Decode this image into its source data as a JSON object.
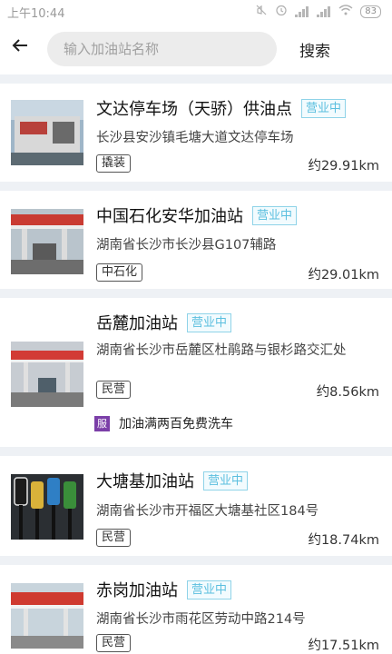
{
  "status_bar": {
    "time": "上午10:44",
    "battery": "83",
    "icons": [
      "mute-icon",
      "alarm-icon",
      "signal-icon",
      "signal-icon",
      "wifi-icon",
      "battery-icon"
    ]
  },
  "search": {
    "placeholder": "输入加油站名称",
    "button_label": "搜索",
    "back_icon": "back-arrow-icon"
  },
  "stations": [
    {
      "name": "文达停车场（天骄）供油点",
      "status": "营业中",
      "address": "长沙县安沙镇毛塘大道文达停车场",
      "tag": "撬装",
      "distance": "约29.91km",
      "promo": ""
    },
    {
      "name": "中国石化安华加油站",
      "status": "营业中",
      "address": "湖南省长沙市长沙县G107辅路",
      "tag": "中石化",
      "distance": "约29.01km",
      "promo": ""
    },
    {
      "name": "岳麓加油站",
      "status": "营业中",
      "address": "湖南省长沙市岳麓区杜鹃路与银杉路交汇处",
      "tag": "民营",
      "distance": "约8.56km",
      "promo": "加油满两百免费洗车",
      "promo_icon_label": "服"
    },
    {
      "name": "大塘基加油站",
      "status": "营业中",
      "address": "湖南省长沙市开福区大塘基社区184号",
      "tag": "民营",
      "distance": "约18.74km",
      "promo": ""
    },
    {
      "name": "赤岗加油站",
      "status": "营业中",
      "address": "湖南省长沙市雨花区劳动中路214号",
      "tag": "民营",
      "distance": "约17.51km",
      "promo": ""
    }
  ],
  "colors": {
    "accent": "#5bbfdf",
    "promo_icon": "#7b3fa8",
    "background": "#eef1f5"
  }
}
